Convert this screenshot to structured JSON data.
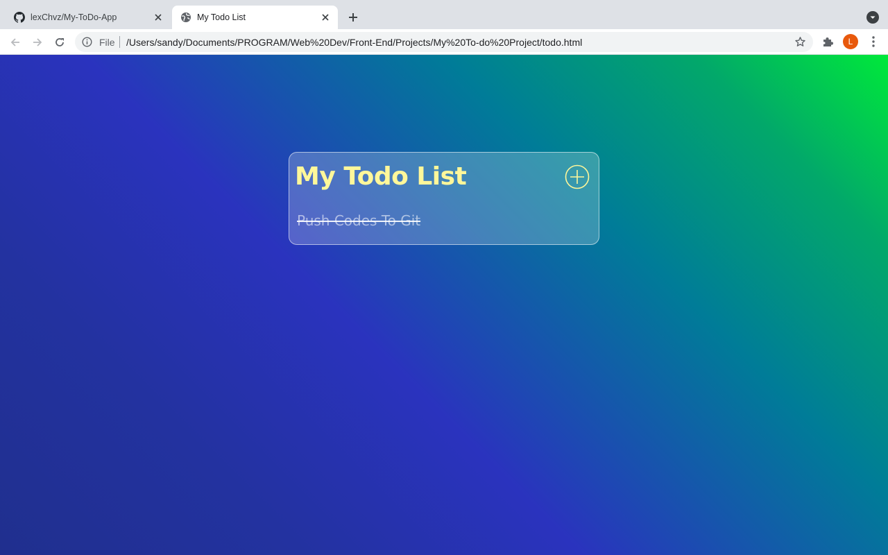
{
  "browser": {
    "tabs": [
      {
        "title": "lexChvz/My-ToDo-App",
        "icon": "github-icon",
        "active": false
      },
      {
        "title": "My Todo List",
        "icon": "globe-icon",
        "active": true
      }
    ],
    "omnibox": {
      "scheme_label": "File",
      "url": "/Users/sandy/Documents/PROGRAM/Web%20Dev/Front-End/Projects/My%20To-do%20Project/todo.html"
    },
    "profile_initial": "L",
    "profile_color": "#e8590c"
  },
  "page": {
    "title": "My Todo List",
    "title_color": "#fff79a",
    "add_button_icon": "plus-circle-icon",
    "todos": [
      {
        "text": "Push Codes To Git",
        "completed": true
      }
    ]
  }
}
